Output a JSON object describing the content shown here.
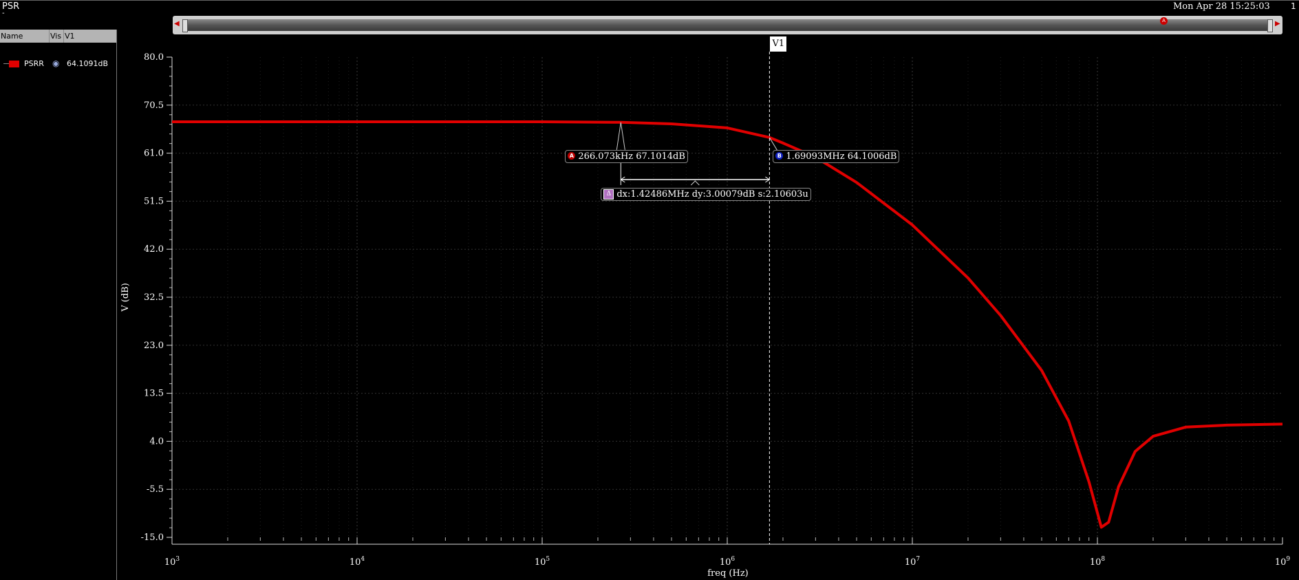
{
  "window": {
    "title": "PSR",
    "subtitle": "-",
    "timestamp": "Mon Apr 28 15:25:03",
    "page_number": "1"
  },
  "legend": {
    "columns": [
      "Name",
      "Vis",
      "V1"
    ],
    "rows": [
      {
        "name": "PSRR",
        "visible_icon": "eye-icon",
        "v1": "64.1091dB",
        "color": "#e00000"
      }
    ]
  },
  "markers": {
    "a": {
      "label": "A",
      "text": "266.073kHz 67.1014dB",
      "color": "#c00000"
    },
    "b": {
      "label": "B",
      "text": "1.69093MHz 64.1006dB",
      "color": "#1020c0"
    },
    "delta": {
      "label": "Δ",
      "text": "dx:1.42486MHz dy:3.00079dB s:2.10603u"
    },
    "vertical": {
      "label": "V1"
    }
  },
  "chart_data": {
    "type": "line",
    "title": "",
    "xlabel": "freq (Hz)",
    "ylabel": "V (dB)",
    "xscale": "log",
    "xlim": [
      1000,
      1000000000
    ],
    "ylim": [
      -15.0,
      80.0
    ],
    "grid": true,
    "yticks": [
      "80.0",
      "70.5",
      "61.0",
      "51.5",
      "42.0",
      "32.5",
      "23.0",
      "13.5",
      "4.0",
      "-5.5",
      "-15.0"
    ],
    "xticks": [
      {
        "base": "10",
        "exp": "3"
      },
      {
        "base": "10",
        "exp": "4"
      },
      {
        "base": "10",
        "exp": "5"
      },
      {
        "base": "10",
        "exp": "6"
      },
      {
        "base": "10",
        "exp": "7"
      },
      {
        "base": "10",
        "exp": "8"
      },
      {
        "base": "10",
        "exp": "9"
      }
    ],
    "series": [
      {
        "name": "PSRR",
        "color": "#e00000",
        "x": [
          1000,
          10000,
          100000,
          266073,
          500000,
          1000000,
          1690930,
          2000000,
          3000000,
          5000000,
          10000000,
          20000000,
          30000000,
          50000000,
          70000000,
          90000000,
          105000000,
          115000000,
          130000000,
          160000000,
          200000000,
          300000000,
          500000000,
          1000000000
        ],
        "y": [
          67.2,
          67.2,
          67.2,
          67.1,
          66.8,
          66.0,
          64.1,
          63.0,
          60.2,
          55.2,
          46.8,
          36.3,
          28.9,
          18.0,
          8.0,
          -4.0,
          -13.0,
          -12.0,
          -5.0,
          2.0,
          5.0,
          6.8,
          7.2,
          7.4
        ]
      }
    ],
    "cursor_x": 1690930,
    "marker_a": {
      "x": 266073,
      "y": 67.1014
    },
    "marker_b": {
      "x": 1690930,
      "y": 64.1006
    }
  }
}
